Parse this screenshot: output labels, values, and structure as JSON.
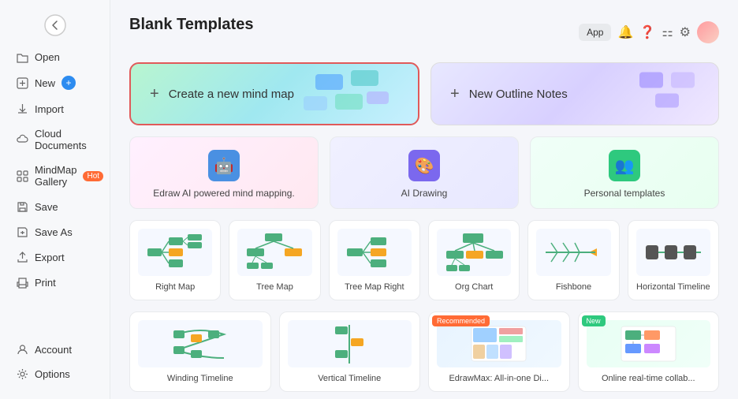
{
  "header": {
    "back_label": "←",
    "app_label": "App",
    "title": "Blank Templates"
  },
  "sidebar": {
    "items": [
      {
        "id": "open",
        "label": "Open",
        "icon": "📂"
      },
      {
        "id": "new",
        "label": "New",
        "icon": "✨",
        "has_plus": true
      },
      {
        "id": "import",
        "label": "Import",
        "icon": "⬇"
      },
      {
        "id": "cloud",
        "label": "Cloud Documents",
        "icon": "☁"
      },
      {
        "id": "gallery",
        "label": "MindMap Gallery",
        "icon": "🗂",
        "badge": "Hot"
      },
      {
        "id": "save",
        "label": "Save",
        "icon": "💾"
      },
      {
        "id": "saveas",
        "label": "Save As",
        "icon": "📄"
      },
      {
        "id": "export",
        "label": "Export",
        "icon": "📤"
      },
      {
        "id": "print",
        "label": "Print",
        "icon": "🖨"
      }
    ],
    "bottom_items": [
      {
        "id": "account",
        "label": "Account",
        "icon": "👤"
      },
      {
        "id": "options",
        "label": "Options",
        "icon": "⚙"
      }
    ]
  },
  "main": {
    "top_cards": [
      {
        "id": "create-mindmap",
        "label": "Create a new mind map",
        "plus": "+",
        "selected": true
      },
      {
        "id": "new-outline",
        "label": "New Outline Notes",
        "plus": "+"
      }
    ],
    "feature_cards": [
      {
        "id": "edraw-ai",
        "label": "Edraw AI powered mind mapping.",
        "icon": "🤖",
        "color": "#4a90e2"
      },
      {
        "id": "ai-drawing",
        "label": "AI Drawing",
        "icon": "🎨",
        "color": "#7b68ee"
      },
      {
        "id": "personal-templates",
        "label": "Personal templates",
        "icon": "👥",
        "color": "#2ec97e"
      }
    ],
    "template_cards": [
      {
        "id": "right-map",
        "label": "Right Map"
      },
      {
        "id": "tree-map",
        "label": "Tree Map"
      },
      {
        "id": "tree-map-right",
        "label": "Tree Map Right"
      },
      {
        "id": "org-chart",
        "label": "Org Chart"
      },
      {
        "id": "fishbone",
        "label": "Fishbone"
      },
      {
        "id": "horizontal-timeline",
        "label": "Horizontal Timeline"
      }
    ],
    "template_cards_2": [
      {
        "id": "winding-timeline",
        "label": "Winding Timeline"
      },
      {
        "id": "vertical-timeline",
        "label": "Vertical Timeline"
      },
      {
        "id": "edrawmax-all",
        "label": "EdrawMax: All-in-one Di...",
        "badge": "Recommended",
        "badge_type": "recommended"
      },
      {
        "id": "online-collab",
        "label": "Online real-time collab...",
        "badge": "New",
        "badge_type": "new"
      }
    ]
  }
}
